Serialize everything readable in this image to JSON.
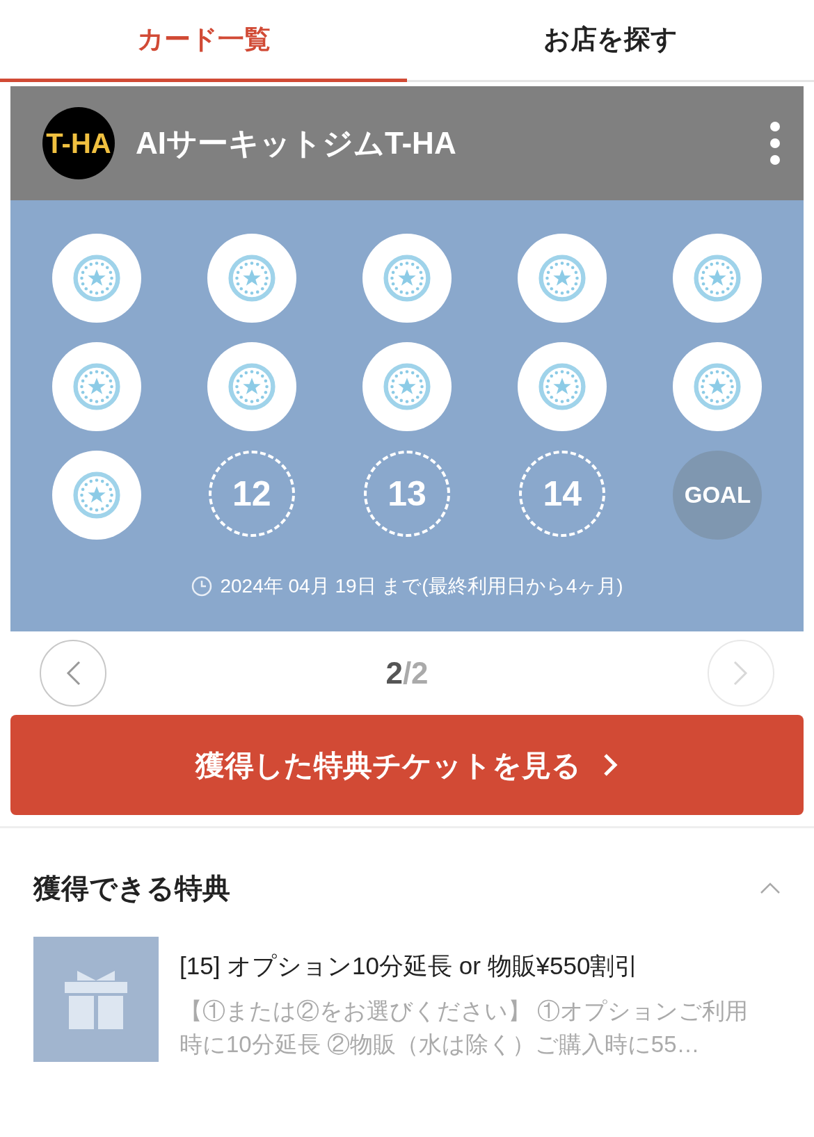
{
  "tabs": [
    {
      "label": "カード一覧",
      "selected": true
    },
    {
      "label": "お店を探す",
      "selected": false
    }
  ],
  "card": {
    "logo_text": "T-HA",
    "shop_name": "AIサーキットジムT-HA",
    "stamps": [
      {
        "kind": "stamped"
      },
      {
        "kind": "stamped"
      },
      {
        "kind": "stamped"
      },
      {
        "kind": "stamped"
      },
      {
        "kind": "stamped"
      },
      {
        "kind": "stamped"
      },
      {
        "kind": "stamped"
      },
      {
        "kind": "stamped"
      },
      {
        "kind": "stamped"
      },
      {
        "kind": "stamped"
      },
      {
        "kind": "stamped"
      },
      {
        "kind": "empty",
        "label": "12"
      },
      {
        "kind": "empty",
        "label": "13"
      },
      {
        "kind": "empty",
        "label": "14"
      },
      {
        "kind": "goal",
        "label": "GOAL"
      }
    ],
    "expiry": "2024年 04月 19日 まで(最終利用日から4ヶ月)"
  },
  "pager": {
    "current": "2",
    "total": "/2",
    "prev_disabled": false,
    "next_disabled": true
  },
  "ticket_button": "獲得した特典チケットを見る",
  "rewards": {
    "title": "獲得できる特典",
    "expanded": true,
    "items": [
      {
        "title": "[15] オプション10分延長 or 物販¥550割引",
        "description": "【①または②をお選びください】 ①オプションご利用時に10分延長 ②物販（水は除く）ご購入時に55…"
      }
    ]
  }
}
